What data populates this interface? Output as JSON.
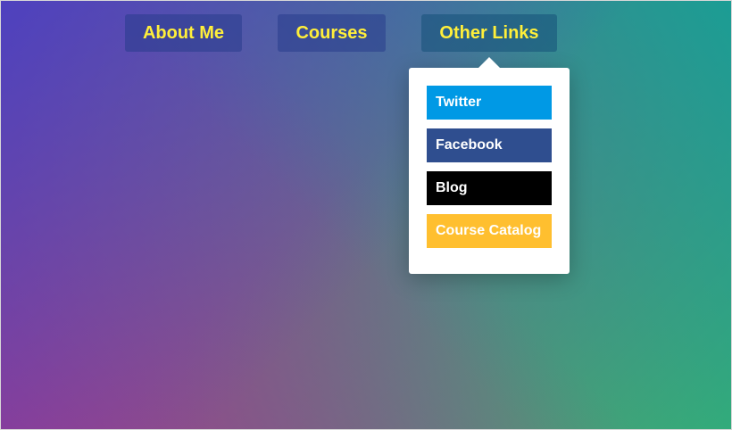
{
  "nav": {
    "items": [
      {
        "label": "About Me"
      },
      {
        "label": "Courses"
      },
      {
        "label": "Other Links"
      }
    ]
  },
  "dropdown": {
    "links": [
      {
        "label": "Twitter",
        "color": "#0099e5"
      },
      {
        "label": "Facebook",
        "color": "#2f4e8f"
      },
      {
        "label": "Blog",
        "color": "#000000"
      },
      {
        "label": "Course Catalog",
        "color": "#ffbf2f"
      }
    ]
  },
  "colors": {
    "nav_text": "#ffef3a",
    "dropdown_bg": "#ffffff"
  }
}
